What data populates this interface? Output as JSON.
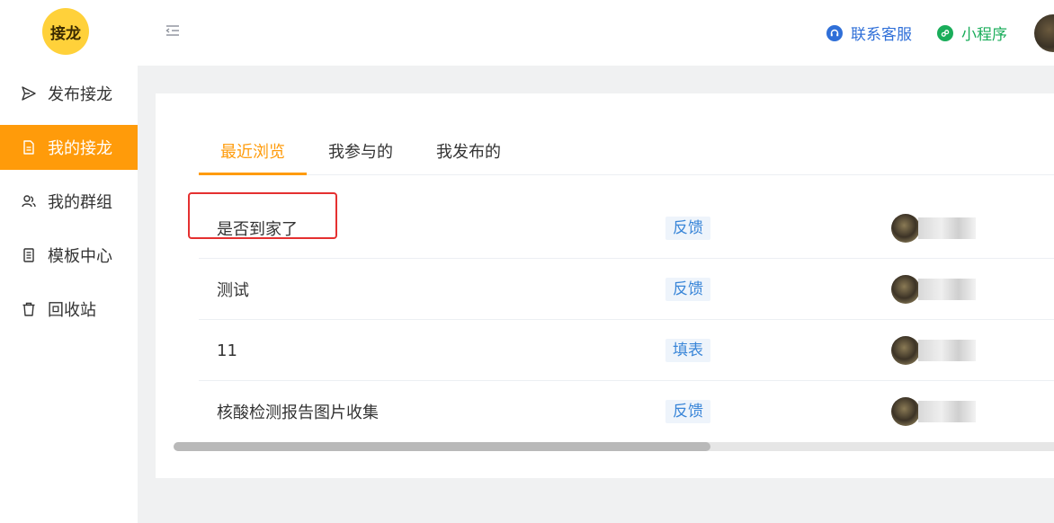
{
  "header": {
    "logo_text": "接龙",
    "service_label": "联系客服",
    "miniprogram_label": "小程序",
    "colors": {
      "service": "#2f6fd8",
      "miniprogram": "#1aad5a",
      "accent": "#ff9b0a"
    }
  },
  "sidebar": {
    "items": [
      {
        "label": "发布接龙",
        "icon": "send-icon"
      },
      {
        "label": "我的接龙",
        "icon": "document-icon",
        "active": true
      },
      {
        "label": "我的群组",
        "icon": "group-icon"
      },
      {
        "label": "模板中心",
        "icon": "template-icon"
      },
      {
        "label": "回收站",
        "icon": "trash-icon"
      }
    ]
  },
  "tabs": [
    {
      "label": "最近浏览",
      "active": true
    },
    {
      "label": "我参与的"
    },
    {
      "label": "我发布的"
    }
  ],
  "list": [
    {
      "title": "是否到家了",
      "type": "反馈"
    },
    {
      "title": "测试",
      "type": "反馈"
    },
    {
      "title": "11",
      "type": "填表"
    },
    {
      "title": "核酸检测报告图片收集",
      "type": "反馈"
    }
  ],
  "scrollbar": {
    "position_fraction": 0.0,
    "visible_fraction": 0.6
  }
}
